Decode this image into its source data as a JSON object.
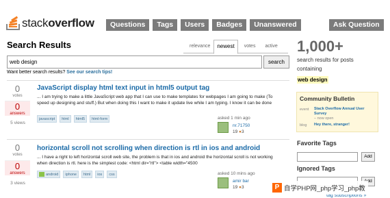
{
  "logo": {
    "prefix": "stack",
    "suffix": "overflow"
  },
  "nav": {
    "items": [
      "Questions",
      "Tags",
      "Users",
      "Badges",
      "Unanswered"
    ],
    "ask": "Ask Question"
  },
  "search": {
    "title": "Search Results",
    "tabs": [
      "relevance",
      "newest",
      "votes",
      "active"
    ],
    "query": "web design",
    "button": "search",
    "tip_prefix": "Want better search results?",
    "tip_link": "See our search tips!"
  },
  "questions": [
    {
      "votes": "0",
      "votes_label": "votes",
      "answers": "0",
      "answers_label": "answers",
      "views": "5 views",
      "title": "JavaScript display html text input in html5 output tag",
      "excerpt": "... I am trying to make a little JavaScript web app that I can use to make templates for webpages I am going to make (To speed up designing and stuff.) But when doing this I want to make it update live while I am typing. I know it can be done",
      "tags": [
        "javascript",
        "html",
        "html5",
        "html-form"
      ],
      "asked": "asked 1 min ago",
      "user": "nr.71750",
      "rep": "19",
      "bronze": "3"
    },
    {
      "votes": "0",
      "votes_label": "votes",
      "answers": "0",
      "answers_label": "answers",
      "views": "3 views",
      "title": "horizontal scroll not scrolling when direction is rtl in ios and android",
      "excerpt": "... I have a right to left horizontal scroll web site, the problem is that in ios and android the horizontal scroll is not working when direction is rtl. here is the simplest code: <html dir=\"rtl\"> <table width=\"4500",
      "tags": [
        "android",
        "iphone",
        "html",
        "ios",
        "css"
      ],
      "asked": "asked 10 mins ago",
      "user": "amir bar",
      "rep": "19",
      "bronze": "3"
    }
  ],
  "sidebar": {
    "count": "1,000+",
    "count_text": "search results for posts containing",
    "query_tag": "web design",
    "community": {
      "heading": "Community Bulletin",
      "rows": [
        {
          "label": "event",
          "value": "Stack Overflow Annual User Survey",
          "sub": "– now open"
        },
        {
          "label": "blog",
          "value": "Hey there, stranger!",
          "sub": ""
        }
      ]
    },
    "favorite_heading": "Favorite Tags",
    "ignored_heading": "Ignored Tags",
    "add_label": "Add",
    "subscribe_link": "tag subscriptions »"
  },
  "watermark": {
    "icon": "P",
    "text": "自学PHP网_php学习_php教"
  },
  "colors": {
    "link": "#1a6aa7",
    "nav_bg": "#7b7b7b",
    "accent": "#f48024",
    "answers_bg": "#fde9ea",
    "highlight": "#fffbbe"
  }
}
